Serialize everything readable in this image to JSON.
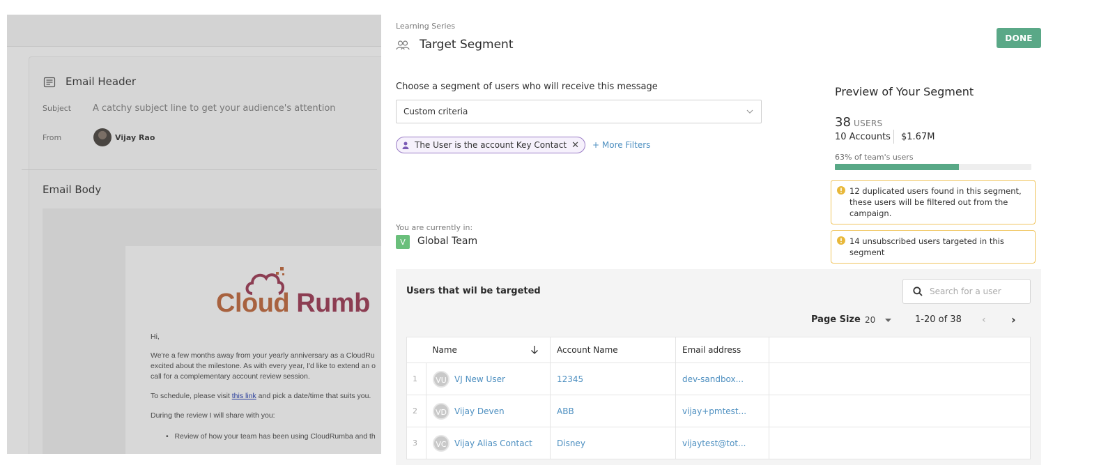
{
  "background": {
    "email_header_title": "Email Header",
    "subject_label": "Subject",
    "subject_value": "A catchy subject line to get your audience's attention",
    "from_label": "From",
    "from_name": "Vijay Rao",
    "email_body_title": "Email Body",
    "logo_cloud": "Cloud",
    "logo_rumba": "Rumb",
    "letter_lines": {
      "hi": "Hi,",
      "p1a": "We're a few months away from your yearly anniversary as a CloudRu",
      "p1b": "excited about the milestone. As with every year, I'd like to extend an o",
      "p1c": "call for a complementary account review session.",
      "p2_pre": "To schedule, please visit ",
      "p2_link": "this link",
      "p2_post": " and pick a date/time that suits you.",
      "p3": "During the review I will share with you:",
      "bullet1": "Review of how your team has been using CloudRumba and th"
    }
  },
  "panel": {
    "eyebrow": "Learning Series",
    "title": "Target Segment",
    "done_label": "DONE",
    "choose_label": "Choose a segment of users who will receive this message",
    "select_value": "Custom criteria",
    "filter_chip": "The User is the account Key Contact",
    "more_filters": "+ More Filters",
    "current_label": "You are currently in:",
    "team_badge": "V",
    "team_name": "Global Team"
  },
  "preview": {
    "title": "Preview of Your Segment",
    "users_count": "38",
    "users_label": "USERS",
    "accounts": "10 Accounts",
    "amount": "$1.67M",
    "pct_label": "63% of team's users",
    "pct_fraction": 0.63,
    "warnings": [
      "12 duplicated users found in this segment, these users will be filtered out from the campaign.",
      "14 unsubscribed users targeted in this segment"
    ]
  },
  "table": {
    "title": "Users that wil be targeted",
    "search_placeholder": "Search for a user",
    "page_size_label": "Page Size",
    "page_size_value": "20",
    "range": "1-20 of 38",
    "columns": [
      "Name",
      "Account Name",
      "Email address"
    ],
    "rows": [
      {
        "idx": "1",
        "initials": "VU",
        "name": "VJ New User",
        "account": "12345",
        "email": "dev-sandbox..."
      },
      {
        "idx": "2",
        "initials": "VD",
        "name": "Vijay Deven",
        "account": "ABB",
        "email": "vijay+pmtest..."
      },
      {
        "idx": "3",
        "initials": "VC",
        "name": "Vijay Alias Contact",
        "account": "Disney",
        "email": "vijaytest@tot..."
      }
    ]
  },
  "colors": {
    "accent_green": "#5aa887",
    "link_blue": "#4d8fc0",
    "chip_purple": "#9a7cc6",
    "warning_yellow": "#f0c55f"
  }
}
